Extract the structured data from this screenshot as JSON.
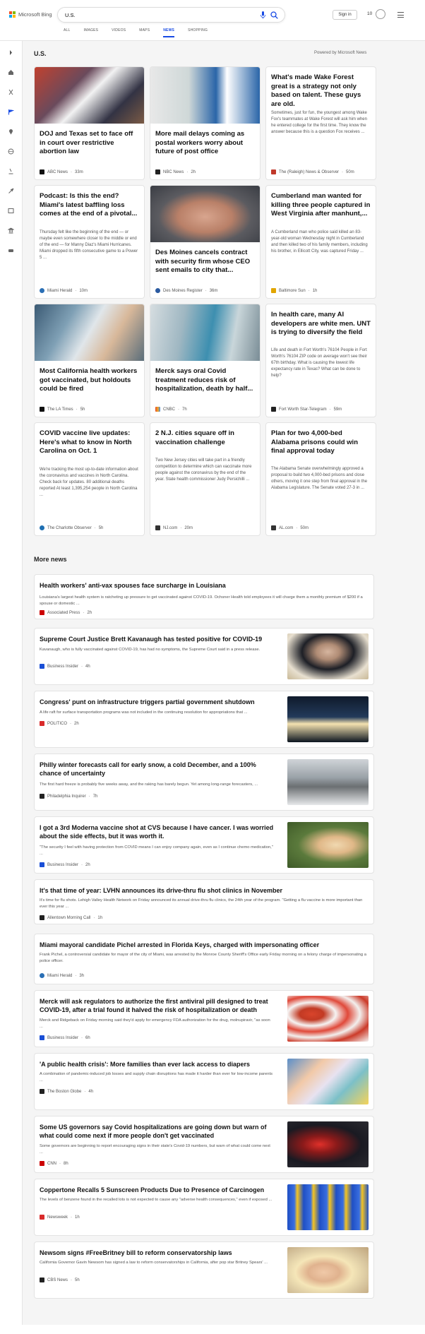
{
  "header": {
    "logo_text": "Microsoft Bing",
    "search_value": "U.S.",
    "signin_label": "Sign in",
    "rewards_count": "10",
    "tabs": [
      {
        "label": "ALL"
      },
      {
        "label": "IMAGES"
      },
      {
        "label": "VIDEOS"
      },
      {
        "label": "MAPS"
      },
      {
        "label": "NEWS"
      },
      {
        "label": "SHOPPING"
      }
    ],
    "active_tab": "NEWS"
  },
  "sidebar": {
    "icons": [
      "chevron-right-icon",
      "home-icon",
      "science-icon",
      "flag-icon",
      "map-pin-icon",
      "globe-icon",
      "microscope-icon",
      "rocket-icon",
      "film-icon",
      "bank-icon",
      "car-icon"
    ]
  },
  "main": {
    "section_title": "U.S.",
    "powered_by": "Powered by Microsoft News",
    "cards": [
      {
        "title": "DOJ and Texas set to face off in court over restrictive abortion law",
        "snippet": "",
        "source": "ABC News",
        "time": "33m",
        "favicon_color": "#111111",
        "has_image": true
      },
      {
        "title": "More mail delays coming as postal workers worry about future of post office",
        "snippet": "",
        "source": "NBC News",
        "time": "2h",
        "favicon_color": "#222222",
        "has_image": true
      },
      {
        "title": "What's made Wake Forest great is a strategy not only based on talent. These guys are old.",
        "snippet": "Sometimes, just for fun, the youngest among Wake Fox's teammates at Wake Forest will ask him when he entered college for the first time. They know the answer because this is a question Fox receives ...",
        "source": "The (Raleigh) News & Observer",
        "time": "50m",
        "favicon_color": "#c0392b",
        "has_image": false
      },
      {
        "title": "Podcast: Is this the end? Miami's latest baffling loss comes at the end of a pivotal...",
        "snippet": "Thursday felt like the beginning of the end — or maybe even somewhere closer to the middle or end of the end — for Manny Diaz's Miami Hurricanes. Miami dropped its fifth consecutive game to a Power 5 ...",
        "source": "Miami Herald",
        "time": "10m",
        "favicon_color": "#2a6fb5",
        "has_image": false
      },
      {
        "title": "Des Moines cancels contract with security firm whose CEO sent emails to city that...",
        "snippet": "",
        "source": "Des Moines Register",
        "time": "36m",
        "favicon_color": "#2b5aa0",
        "has_image": true
      },
      {
        "title": "Cumberland man wanted for killing three people captured in West Virginia after manhunt,...",
        "snippet": "A Cumberland man who police said killed an 83-year-old woman Wednesday night in Cumberland and then killed two of his family members, including his brother, in Ellicott City, was captured Friday ...",
        "source": "Baltimore Sun",
        "time": "1h",
        "favicon_color": "#e1a500",
        "has_image": false
      },
      {
        "title": "Most California health workers got vaccinated, but holdouts could be fired",
        "snippet": "",
        "source": "The LA Times",
        "time": "5h",
        "favicon_color": "#111111",
        "has_image": true
      },
      {
        "title": "Merck says oral Covid treatment reduces risk of hospitalization, death by half...",
        "snippet": "",
        "source": "CNBC",
        "time": "7h",
        "favicon_color": "#e24a2a",
        "has_image": true
      },
      {
        "title": "In health care, many AI developers are white men. UNT is trying to diversify the field",
        "snippet": "Life and death in Fort Worth's 76104 People in Fort Worth's 76104 ZIP code on average won't see their 67th birthday. What is causing the lowest life expectancy rate in Texas? What can be done to help?",
        "source": "Fort Worth Star-Telegram",
        "time": "59m",
        "favicon_color": "#222222",
        "has_image": false
      },
      {
        "title": "COVID vaccine live updates: Here's what to know in North Carolina on Oct. 1",
        "snippet": "We're tracking the most up-to-date information about the coronavirus and vaccines in North Carolina. Check back for updates. 80 additional deaths reported At least 1,395,254 people in North Carolina ...",
        "source": "The Charlotte Observer",
        "time": "5h",
        "favicon_color": "#1f6fb2",
        "has_image": false
      },
      {
        "title": "2 N.J. cities square off in vaccination challenge",
        "snippet": "Two New Jersey cities will take part in a friendly competition to determine which can vaccinate more people against the coronavirus by the end of the year. State health commissioner Judy Persichilli ...",
        "source": "NJ.com",
        "time": "20m",
        "favicon_color": "#333333",
        "has_image": false
      },
      {
        "title": "Plan for two 4,000-bed Alabama prisons could win final approval today",
        "snippet": "The Alabama Senate overwhelmingly approved a proposal to build two 4,000-bed prisons and close others, moving it one step from final approval in the Alabama Legislature. The Senate voted 27-3 in ...",
        "source": "AL.com",
        "time": "50m",
        "favicon_color": "#333333",
        "has_image": false
      }
    ],
    "more_news_title": "More news",
    "more_news": [
      {
        "title": "Health workers' anti-vax spouses face surcharge in Louisiana",
        "snippet": "Louisiana's largest health system is ratcheting up pressure to get vaccinated against COVID-19. Ochsner Health told employees it will charge them a monthly premium of $200 if a spouse or domestic ...",
        "source": "Associated Press",
        "time": "2h",
        "favicon_color": "#cc0000",
        "has_thumb": false
      },
      {
        "title": "Supreme Court Justice Brett Kavanaugh has tested positive for COVID-19",
        "snippet": "Kavanaugh, who is fully vaccinated against COVID-19, has had no symptoms, the Supreme Court said in a press release.",
        "source": "Business Insider",
        "time": "4h",
        "favicon_color": "#1a4fd6",
        "has_thumb": true
      },
      {
        "title": "Congress' punt on infrastructure triggers partial government shutdown",
        "snippet": "A life raft for surface transportation programs was not included in the continuing resolution for appropriations that ...",
        "source": "POLITICO",
        "time": "2h",
        "favicon_color": "#d92b2b",
        "has_thumb": true
      },
      {
        "title": "Philly winter forecasts call for early snow, a cold December, and a 100% chance of uncertainty",
        "snippet": "The first hard freeze is probably five weeks away, and the raking has barely begun. Yet among long-range forecasters, ...",
        "source": "Philadelphia Inquirer",
        "time": "7h",
        "favicon_color": "#222222",
        "has_thumb": true
      },
      {
        "title": "I got a 3rd Moderna vaccine shot at CVS because I have cancer. I was worried about the side effects, but it was worth it.",
        "snippet": "\"The security I feel with having protection from COVID means I can enjoy company again, even as I continue chemo medication,\" ...",
        "source": "Business Insider",
        "time": "2h",
        "favicon_color": "#1a4fd6",
        "has_thumb": true
      },
      {
        "title": "It's that time of year: LVHN announces its drive-thru flu shot clinics in November",
        "snippet": "It's time for flu shots. Lehigh Valley Health Network on Friday announced its annual drive-thru flu clinics, the 24th year of the program. \"Getting a flu vaccine is more important than ever this year ...",
        "source": "Allentown Morning Call",
        "time": "1h",
        "favicon_color": "#222222",
        "has_thumb": false
      },
      {
        "title": "Miami mayoral candidate Pichel arrested in Florida Keys, charged with impersonating officer",
        "snippet": "Frank Pichel, a controversial candidate for mayor of the city of Miami, was arrested by the Monroe County Sheriff's Office early Friday morning on a felony charge of impersonating a police officer.",
        "source": "Miami Herald",
        "time": "3h",
        "favicon_color": "#2a6fb5",
        "has_thumb": false
      },
      {
        "title": "Merck will ask regulators to authorize the first antiviral pill designed to treat COVID-19, after a trial found it halved the risk of hospitalization or death",
        "snippet": "Merck and Ridgeback on Friday morning said they'd apply for emergency FDA authorization for the drug, molnupiravir, \"as soon ...",
        "source": "Business Insider",
        "time": "6h",
        "favicon_color": "#1a4fd6",
        "has_thumb": true
      },
      {
        "title": "'A public health crisis': More families than ever lack access to diapers",
        "snippet": "A combination of pandemic-induced job losses and supply chain disruptions has made it harder than ever for low-income parents ...",
        "source": "The Boston Globe",
        "time": "4h",
        "favicon_color": "#222222",
        "has_thumb": true
      },
      {
        "title": "Some US governors say Covid hospitalizations are going down but warn of what could come next if more people don't get vaccinated",
        "snippet": "Some governors are beginning to report encouraging signs in their state's Covid-19 numbers, but warn of what could come next ...",
        "source": "CNN",
        "time": "8h",
        "favicon_color": "#cc0000",
        "has_thumb": true
      },
      {
        "title": "Coppertone Recalls 5 Sunscreen Products Due to Presence of Carcinogen",
        "snippet": "The levels of benzene found in the recalled lots is not expected to cause any \"adverse health consequences,\" even if exposed ...",
        "source": "Newsweek",
        "time": "1h",
        "favicon_color": "#d92b2b",
        "has_thumb": true
      },
      {
        "title": "Newsom signs #FreeBritney bill to reform conservatorship laws",
        "snippet": "California Governor Gavin Newsom has signed a law to reform conservatorships in California, after pop star Britney Spears' ...",
        "source": "CBS News",
        "time": "5h",
        "favicon_color": "#222222",
        "has_thumb": true
      }
    ]
  },
  "colors": {
    "accent": "#174ae4",
    "page_bg": "#f5f5f5"
  }
}
